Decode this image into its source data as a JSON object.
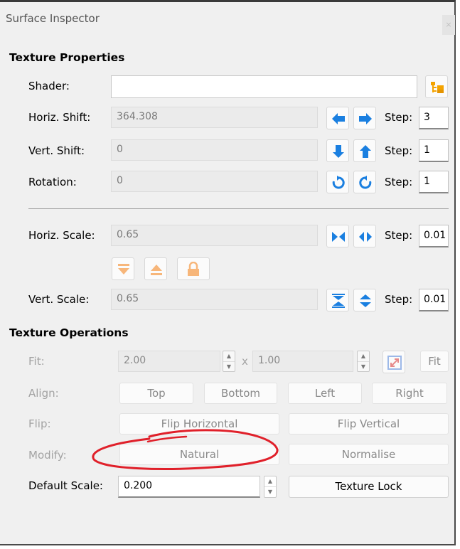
{
  "window": {
    "title": "Surface Inspector",
    "close_label": "×"
  },
  "texture_properties": {
    "heading": "Texture Properties",
    "shader": {
      "label": "Shader:",
      "value": "",
      "browse_icon": "folder-tree-icon"
    },
    "horiz_shift": {
      "label": "Horiz. Shift:",
      "value": "364.308",
      "step_label": "Step:",
      "step_value": "3"
    },
    "vert_shift": {
      "label": "Vert. Shift:",
      "value": "0",
      "step_label": "Step:",
      "step_value": "1"
    },
    "rotation": {
      "label": "Rotation:",
      "value": "0",
      "step_label": "Step:",
      "step_value": "1"
    },
    "horiz_scale": {
      "label": "Horiz. Scale:",
      "value": "0.65",
      "step_label": "Step:",
      "step_value": "0.01"
    },
    "vert_scale": {
      "label": "Vert. Scale:",
      "value": "0.65",
      "step_label": "Step:",
      "step_value": "0.01"
    }
  },
  "texture_operations": {
    "heading": "Texture Operations",
    "fit": {
      "label": "Fit:",
      "width": "2.00",
      "times": "x",
      "height": "1.00",
      "button": "Fit"
    },
    "align": {
      "label": "Align:",
      "buttons": [
        "Top",
        "Bottom",
        "Left",
        "Right"
      ]
    },
    "flip": {
      "label": "Flip:",
      "buttons": [
        "Flip Horizontal",
        "Flip Vertical"
      ]
    },
    "modify": {
      "label": "Modify:",
      "buttons": [
        "Natural",
        "Normalise"
      ]
    },
    "default_scale": {
      "label": "Default Scale:",
      "value": "0.200",
      "button": "Texture Lock"
    }
  },
  "colors": {
    "accent_blue": "#1a7fe0",
    "accent_orange": "#f4a300",
    "annotation_red": "#e0202a"
  }
}
